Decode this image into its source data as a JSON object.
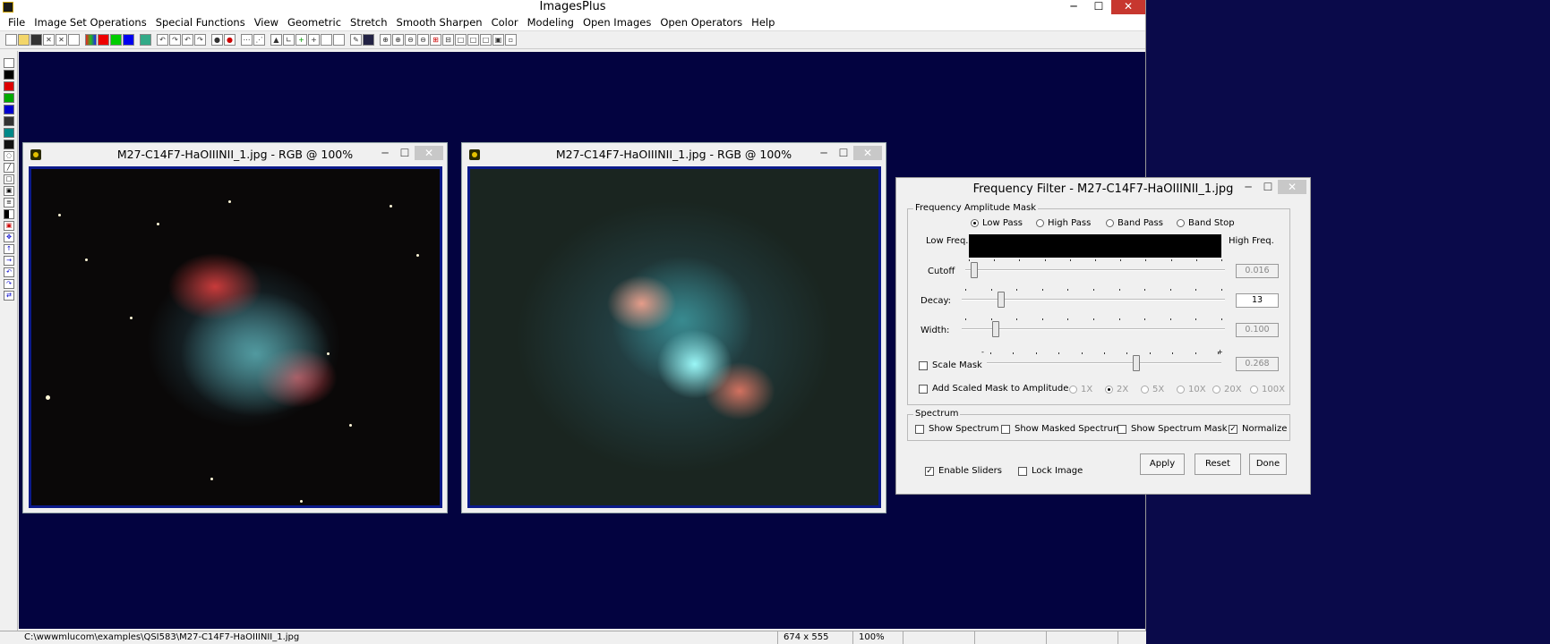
{
  "app": {
    "title": "ImagesPlus"
  },
  "menu": [
    "File",
    "Image Set Operations",
    "Special Functions",
    "View",
    "Geometric",
    "Stretch",
    "Smooth Sharpen",
    "Color",
    "Modeling",
    "Open Images",
    "Open Operators",
    "Help"
  ],
  "image_windows": [
    {
      "title": "M27-C14F7-HaOIIINII_1.jpg - RGB @ 100%"
    },
    {
      "title": "M27-C14F7-HaOIIINII_1.jpg - RGB @ 100%"
    }
  ],
  "dialog": {
    "title": "Frequency Filter - M27-C14F7-HaOIIINII_1.jpg",
    "mask_group": "Frequency Amplitude Mask",
    "modes": [
      "Low Pass",
      "High Pass",
      "Band Pass",
      "Band Stop"
    ],
    "selected_mode": "Low Pass",
    "low_freq_label": "Low Freq.",
    "high_freq_label": "High Freq.",
    "cutoff": {
      "label": "Cutoff",
      "value": "0.016",
      "level": 0.02
    },
    "decay": {
      "label": "Decay:",
      "value": "13",
      "level": 0.14
    },
    "width": {
      "label": "Width:",
      "value": "0.100",
      "level": 0.12
    },
    "scale_mask": {
      "label": "Scale Mask",
      "value": "0.268",
      "level": 0.64,
      "minus": "-",
      "plus": "+"
    },
    "add_scaled": {
      "label": "Add Scaled Mask to Amplitude",
      "factors": [
        "1X",
        "2X",
        "5X",
        "10X",
        "20X",
        "100X"
      ],
      "selected": "2X"
    },
    "spectrum_group": "Spectrum",
    "spectrum_options": [
      {
        "label": "Show Spectrum",
        "checked": false
      },
      {
        "label": "Show Masked Spectrum",
        "checked": false
      },
      {
        "label": "Show Spectrum Mask",
        "checked": false
      },
      {
        "label": "Normalize",
        "checked": true
      }
    ],
    "enable_sliders": "Enable Sliders",
    "lock_image": "Lock Image",
    "apply": "Apply",
    "reset": "Reset",
    "done": "Done"
  },
  "status": {
    "path": "C:\\wwwmlucom\\examples\\QSI583\\M27-C14F7-HaOIIINII_1.jpg",
    "dimensions": "674 x 555",
    "zoom": "100%"
  }
}
